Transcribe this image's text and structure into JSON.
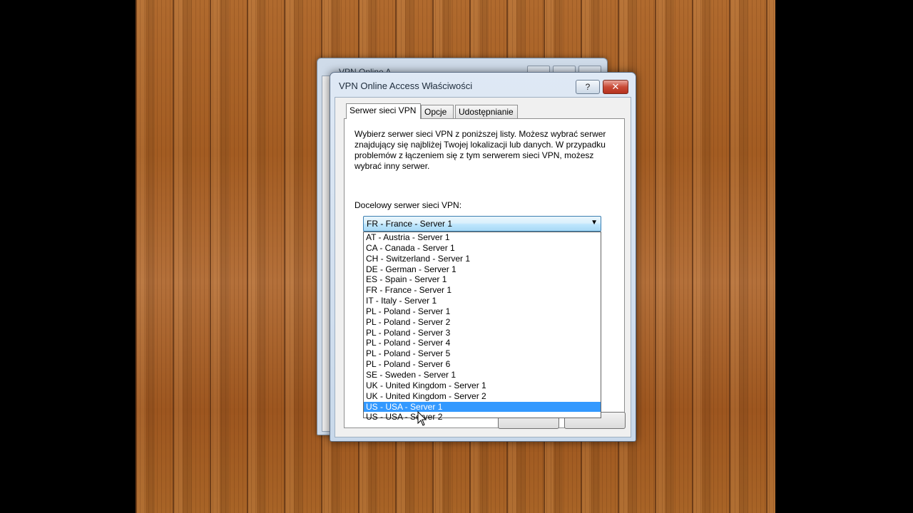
{
  "back_window": {
    "title": "VPN Online A"
  },
  "dialog": {
    "title": "VPN Online Access Właściwości",
    "help_label": "?",
    "close_label": "✕"
  },
  "tabs": [
    {
      "label": "Serwer sieci VPN",
      "active": true
    },
    {
      "label": "Opcje",
      "active": false
    },
    {
      "label": "Udostępnianie",
      "active": false
    }
  ],
  "description": "Wybierz serwer sieci VPN z poniższej listy. Możesz wybrać serwer znajdujący się najbliżej Twojej lokalizacji lub danych. W przypadku problemów z łączeniem się z tym serwerem sieci VPN, możesz wybrać inny serwer.",
  "server_label": "Docelowy serwer sieci VPN:",
  "server_combo": {
    "selected": "FR - France - Server 1",
    "arrow_icon": "chevron-down-icon"
  },
  "dropdown": {
    "options": [
      "AT - Austria - Server 1",
      "CA - Canada - Server 1",
      "CH - Switzerland - Server 1",
      "DE - German - Server 1",
      "ES - Spain - Server 1",
      "FR - France - Server 1",
      "IT - Italy - Server 1",
      "PL - Poland - Server 1",
      "PL - Poland - Server 2",
      "PL - Poland - Server 3",
      "PL - Poland - Server 4",
      "PL - Poland - Server 5",
      "PL - Poland - Server 6",
      "SE - Sweden - Server 1",
      "UK - United Kingdom - Server 1",
      "UK - United Kingdom - Server 2",
      "US - USA - Server 1",
      "US - USA - Server 2"
    ],
    "highlighted": "US - USA - Server 1"
  },
  "colors": {
    "highlight": "#3399ff",
    "combo_border": "#3c7fb1",
    "close_button": "#c94b37"
  }
}
